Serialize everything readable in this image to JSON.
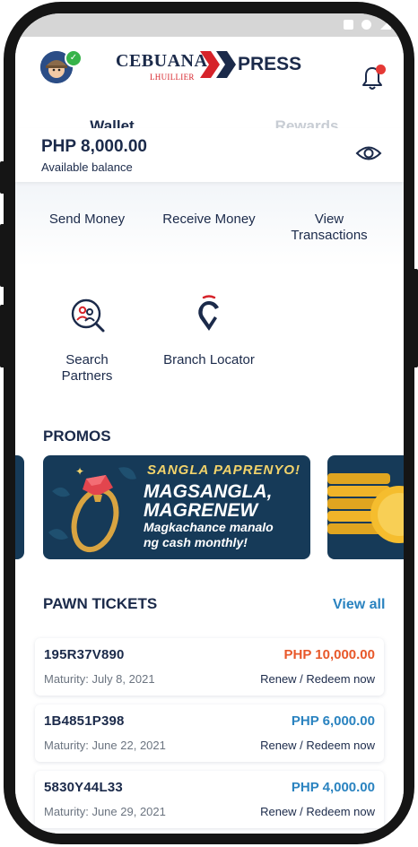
{
  "colors": {
    "navy": "#1b2a4a",
    "accent_blue": "#2a83c0",
    "overdue_orange": "#e8582a",
    "tab_inactive": "#c8cdd4",
    "notification_dot": "#e53935"
  },
  "header": {
    "logo_primary": "CEBUANA",
    "logo_secondary": "LHUILLIER",
    "logo_express": "PRESS"
  },
  "tabs": [
    {
      "label": "Wallet",
      "active": true
    },
    {
      "label": "Rewards",
      "active": false
    }
  ],
  "balance": {
    "amount": "PHP 8,000.00",
    "label": "Available balance"
  },
  "quick_actions": {
    "send": "Send Money",
    "receive": "Receive Money",
    "view_line1": "View",
    "view_line2": "Transactions",
    "search_line1": "Search",
    "search_line2": "Partners",
    "branch": "Branch Locator"
  },
  "promos": {
    "title": "PROMOS",
    "banner": {
      "headline": "SANGLA PAPRENYO!",
      "line1": "MAGSANGLA,",
      "line2": "MAGRENEW",
      "line3": "Magkachance manalo",
      "line4": "ng cash monthly!"
    }
  },
  "pawn_tickets": {
    "title": "PAWN TICKETS",
    "view_all": "View all",
    "items": [
      {
        "id": "195R37V890",
        "amount": "PHP 10,000.00",
        "maturity": "Maturity: July 8, 2021",
        "action": "Renew / Redeem now",
        "amount_color": "#e8582a"
      },
      {
        "id": "1B4851P398",
        "amount": "PHP 6,000.00",
        "maturity": "Maturity: June 22, 2021",
        "action": "Renew / Redeem now",
        "amount_color": "#2a83c0"
      },
      {
        "id": "5830Y44L33",
        "amount": "PHP 4,000.00",
        "maturity": "Maturity: June 29, 2021",
        "action": "Renew / Redeem now",
        "amount_color": "#2a83c0"
      }
    ]
  },
  "icons": [
    "avatar",
    "verified-check-icon",
    "bell-icon",
    "eye-icon",
    "search-partners-icon",
    "location-pin-icon"
  ]
}
